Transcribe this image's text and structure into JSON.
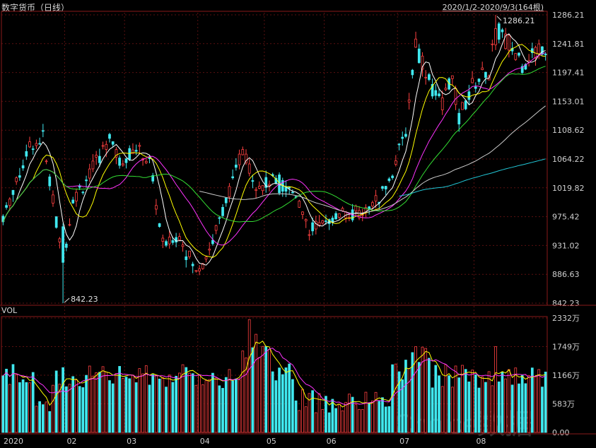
{
  "header": {
    "title": "数字货币（日线）",
    "range": "2020/1/2-2020/9/3(164根)"
  },
  "volume_panel": {
    "title": "VOL"
  },
  "watermark": "Choice数据",
  "colors": {
    "up": "#ff4040",
    "down": "#40e8ef",
    "ma5": "#ffffff",
    "ma10": "#ffff00",
    "ma20": "#ff33ff",
    "ma30": "#33dd33",
    "ma60": "#cccccc",
    "ma120": "#22c8d8",
    "vol_ma5": "#ffff00",
    "vol_ma10": "#ff33ff",
    "grid": "#5a1010",
    "frame": "#8a1a1a"
  },
  "chart_data": [
    {
      "type": "candlestick",
      "y_ticks": [
        "1286.21",
        "1241.81",
        "1197.41",
        "1153.01",
        "1108.62",
        "1064.22",
        "1019.82",
        "975.42",
        "931.02",
        "886.63",
        "842.23"
      ],
      "ylim": [
        842.23,
        1286.21
      ],
      "x_ticks": [
        {
          "index": 0,
          "label": "2020"
        },
        {
          "index": 19,
          "label": "02"
        },
        {
          "index": 37,
          "label": "03"
        },
        {
          "index": 59,
          "label": "04"
        },
        {
          "index": 79,
          "label": "05"
        },
        {
          "index": 97,
          "label": "06"
        },
        {
          "index": 119,
          "label": "07"
        },
        {
          "index": 142,
          "label": "08"
        }
      ],
      "annotations": [
        {
          "text": "1286.21",
          "type": "high",
          "index": 148
        },
        {
          "text": "842.23",
          "type": "low",
          "index": 18
        }
      ],
      "moving_averages": [
        "MA5",
        "MA10",
        "MA20",
        "MA30",
        "MA60",
        "MA120"
      ]
    },
    {
      "type": "bar",
      "name": "VOL",
      "unit": "万",
      "y_ticks": [
        "2332万",
        "1749万",
        "1166万",
        "583万",
        "0.00"
      ],
      "ylim": [
        0,
        2332
      ],
      "moving_averages": [
        "MA5",
        "MA10"
      ]
    }
  ]
}
